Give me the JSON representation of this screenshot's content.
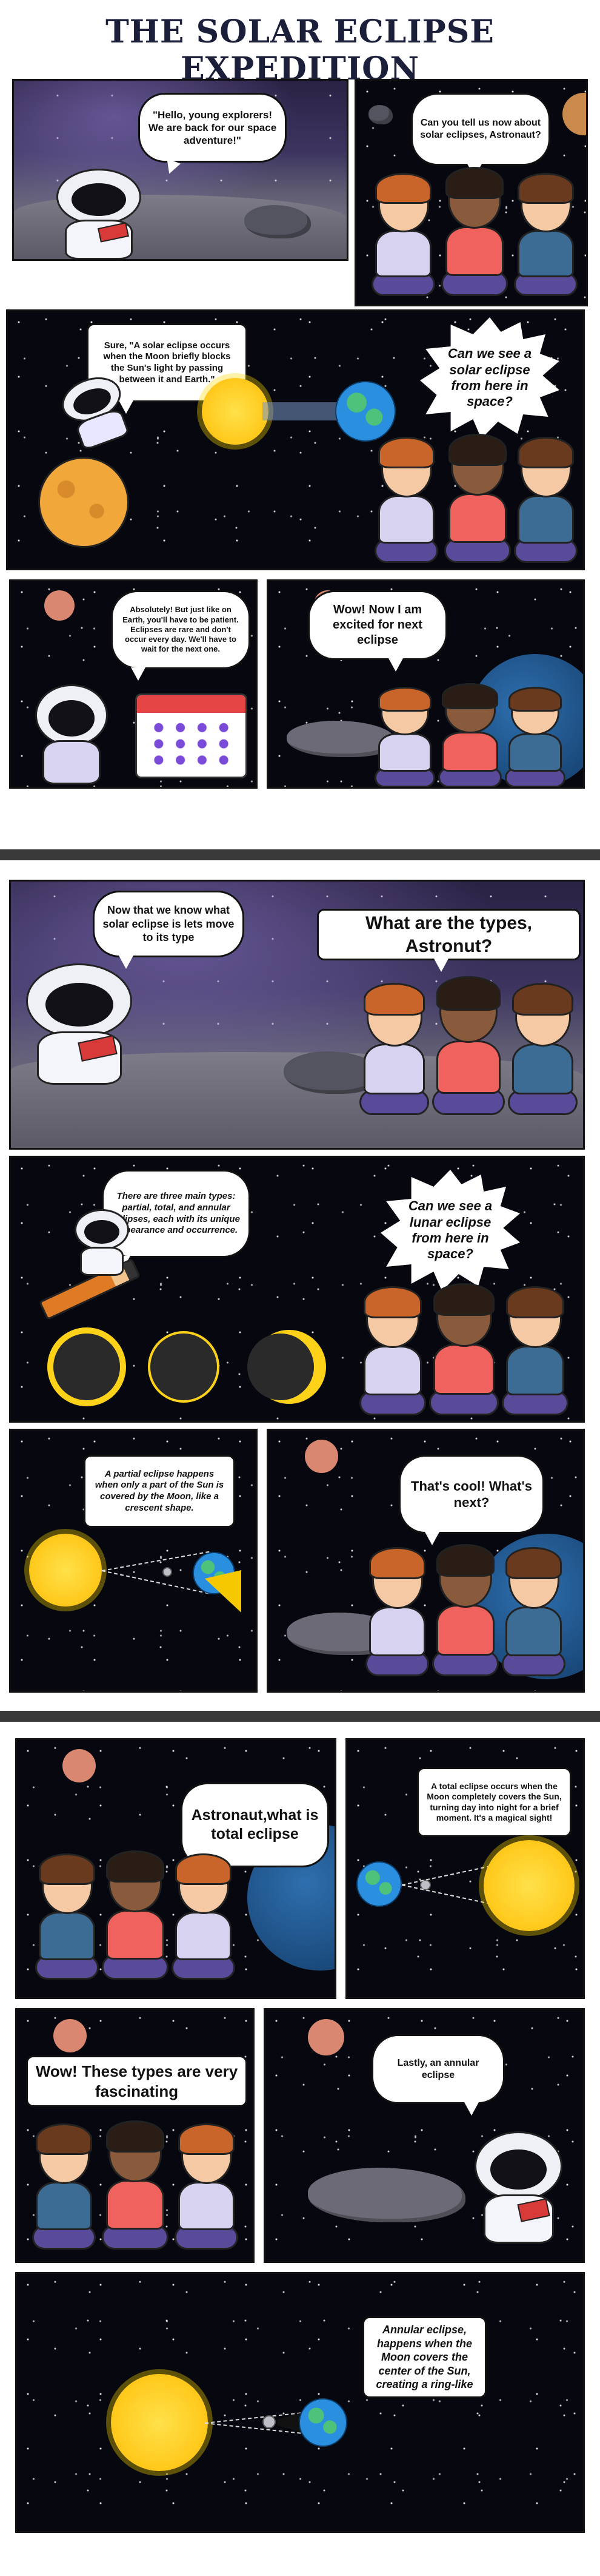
{
  "page": {
    "title": "THE SOLAR ECLIPSE EXPEDITION"
  },
  "bubbles": {
    "b1": "\"Hello, young explorers! We are back for our space adventure!\"",
    "b2": "Can you tell us now about solar eclipses, Astronaut?",
    "b3": "Sure, \"A solar eclipse occurs when the Moon briefly blocks the Sun's light by passing between it and Earth.\"",
    "b4": "Can we see a solar eclipse from here in space?",
    "b5": "Absolutely! But just like on Earth, you'll have to be patient. Eclipses are rare and don't occur every day. We'll have to wait for the next one.",
    "b6": "Wow! Now I am excited for next eclipse",
    "b7": "Now that we know what solar eclipse is lets move to its type",
    "b8": "What are the types, Astronut?",
    "b9": "There are three main types: partial, total, and annular eclipses, each with its unique appearance and occurrence.",
    "b10": "Can we see a lunar eclipse from here in space?",
    "b11": "A partial eclipse happens when only a part of the Sun is covered by the Moon, like a crescent shape.",
    "b12": "That's cool! What's next?",
    "b13": "Astronaut,what is total eclipse",
    "b14": "A total eclipse occurs when the Moon completely covers the Sun, turning day into night for a brief moment. It's a magical sight!",
    "b15": "Wow! These types are very fascinating",
    "b16": "Lastly, an annular eclipse",
    "b17": "Annular eclipse, happens when the Moon covers the center of the Sun, creating a ring-like"
  }
}
